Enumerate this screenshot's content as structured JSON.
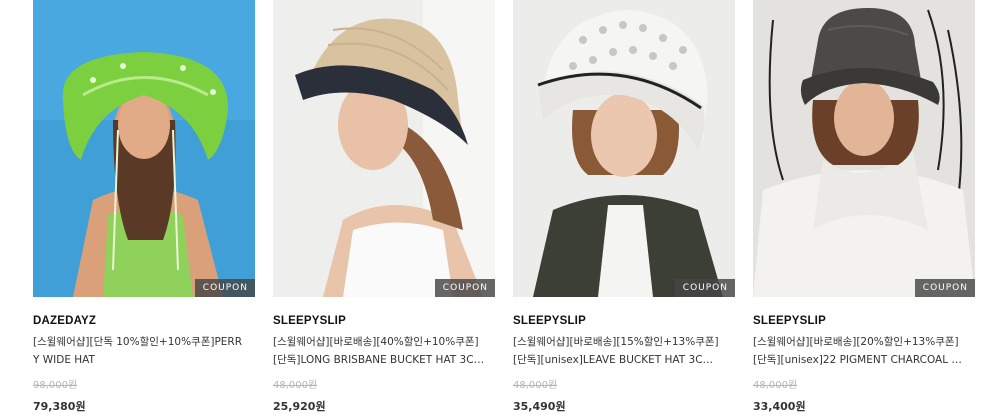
{
  "products": [
    {
      "brand": "DAZEDAYZ",
      "title_line1": "[스윌웨어샵][단독 10%할인+10%쿠폰]PERR",
      "title_line2": "Y WIDE HAT",
      "original_price": "98,000원",
      "sale_price": "79,380원",
      "badge": "COUPON"
    },
    {
      "brand": "SLEEPYSLIP",
      "title_line1": "[스윌웨어샵][바로배송][40%할인+10%쿠폰]",
      "title_line2": "[단독]LONG BRISBANE BUCKET HAT 3C…",
      "original_price": "48,000원",
      "sale_price": "25,920원",
      "badge": "COUPON"
    },
    {
      "brand": "SLEEPYSLIP",
      "title_line1": "[스윌웨어샵][바로배송][15%할인+13%쿠폰]",
      "title_line2": "[단독][unisex]LEAVE BUCKET HAT 3C…",
      "original_price": "48,000원",
      "sale_price": "35,490원",
      "badge": "COUPON"
    },
    {
      "brand": "SLEEPYSLIP",
      "title_line1": "[스윌웨어샵][바로배송][20%할인+13%쿠폰]",
      "title_line2": "[단독][unisex]22 PIGMENT CHARCOAL …",
      "original_price": "48,000원",
      "sale_price": "33,400원",
      "badge": "COUPON"
    }
  ]
}
